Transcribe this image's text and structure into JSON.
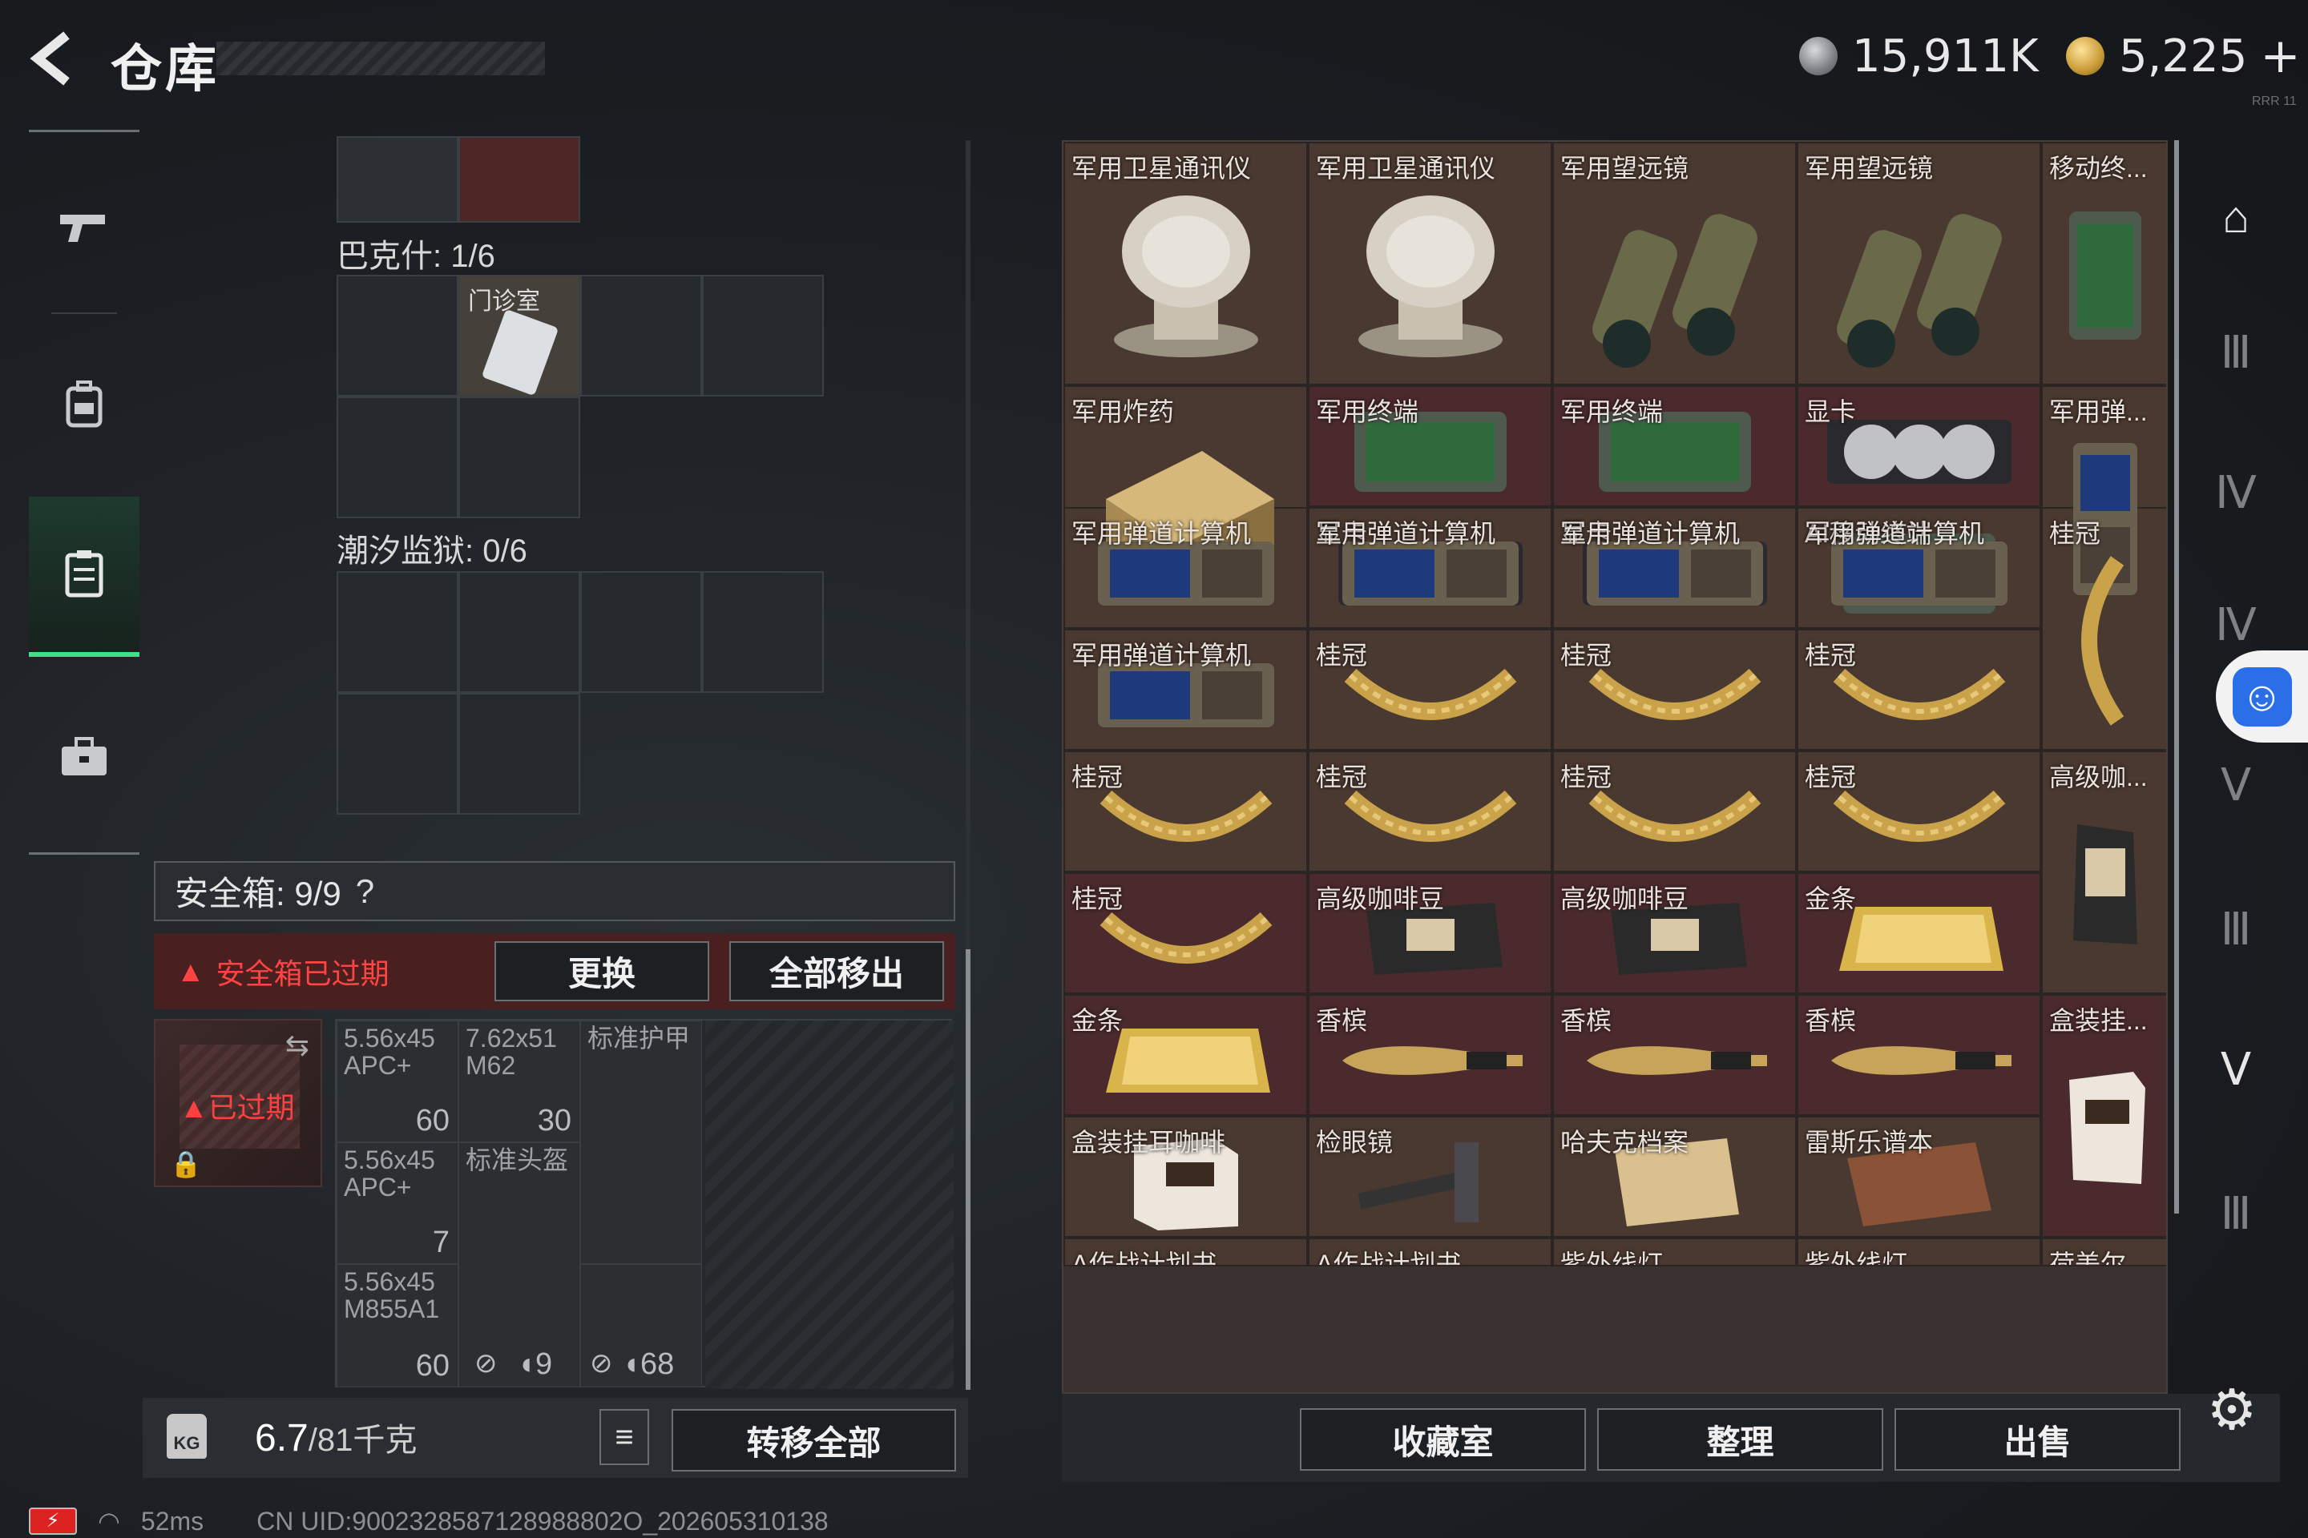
{
  "header": {
    "back_icon": "back-arrow-icon",
    "title": "仓库",
    "silver_amount": "15,911K",
    "gold_amount": "5,225",
    "plus": "+",
    "tiny_tag": "RRR 11"
  },
  "leftnav": {
    "items": [
      {
        "icon": "gun-icon",
        "glyph": "⌐"
      },
      {
        "icon": "backpack-icon",
        "glyph": "⛑"
      },
      {
        "icon": "locker-icon",
        "glyph": "▤"
      },
      {
        "icon": "briefcase-icon",
        "glyph": "💼"
      }
    ],
    "active_index": 2
  },
  "stash": {
    "bakshi_label": "巴克什: 1/6",
    "clinic_label": "门诊室",
    "tide_prison_label": "潮汐监狱: 0/6"
  },
  "safebox": {
    "label": "安全箱: 9/9",
    "help": "?",
    "expired_warning": "安全箱已过期",
    "replace_button": "更换",
    "remove_all_button": "全部移出",
    "case_expired": "已过期",
    "items": [
      {
        "name": "5.56x45 APC+",
        "count": "60"
      },
      {
        "name": "7.62x51 M62",
        "count": "30"
      },
      {
        "name": "标准护甲",
        "count": ""
      },
      {
        "name": "5.56x45 APC+",
        "count": "7"
      },
      {
        "name": "标准头盔",
        "count": ""
      },
      {
        "name": "5.56x45 M855A1",
        "count": "60"
      }
    ],
    "footer_durability_a": "9",
    "footer_durability_b": "68"
  },
  "footer_left": {
    "weight_value": "6.7",
    "weight_unit": "/81千克",
    "weight_icon_text": "KG",
    "transfer_all": "转移全部"
  },
  "status": {
    "ping": "52ms",
    "uid": "CN UID:9002328587128988802O_202605310138"
  },
  "inventory": {
    "rows": [
      [
        "军用卫星通讯仪",
        "军用卫星通讯仪",
        "军用望远镜",
        "军用望远镜",
        "移动终..."
      ],
      [
        "军用炸药",
        "军用终端",
        "军用终端",
        "显卡",
        "军用弹..."
      ],
      [
        "",
        "显卡",
        "显卡",
        "AI移动终端",
        ""
      ],
      [
        "军用弹道计算机",
        "军用弹道计算机",
        "军用弹道计算机",
        "军用弹道计算机",
        "桂冠"
      ],
      [
        "军用弹道计算机",
        "桂冠",
        "桂冠",
        "桂冠",
        ""
      ],
      [
        "桂冠",
        "桂冠",
        "桂冠",
        "桂冠",
        "高级咖..."
      ],
      [
        "桂冠",
        "高级咖啡豆",
        "高级咖啡豆",
        "金条",
        ""
      ],
      [
        "金条",
        "香槟",
        "香槟",
        "香槟",
        "盒装挂..."
      ],
      [
        "盒装挂耳咖啡",
        "检眼镜",
        "哈夫克档案",
        "雷斯乐谱本",
        ""
      ],
      [
        "A作战计划书",
        "A作战计划书",
        "紫外线灯",
        "紫外线灯",
        "荷美尔..."
      ]
    ],
    "bottom_buttons": [
      "收藏室",
      "整理",
      "出售"
    ]
  },
  "rightnav": {
    "items": [
      "arch-icon",
      "tier3-box-icon",
      "tier4-folder-icon",
      "tier4-box-icon",
      "tier5-box-icon",
      "tier3-frame-icon",
      "tier5-box-icon",
      "tier3-frame-icon"
    ],
    "accessibility_icon": "accessibility-icon",
    "settings_icon": "gear-icon"
  },
  "colors": {
    "accent_green": "#3fe08a",
    "warning_red": "#ff4444",
    "accessibility_blue": "#2b6fe8"
  }
}
